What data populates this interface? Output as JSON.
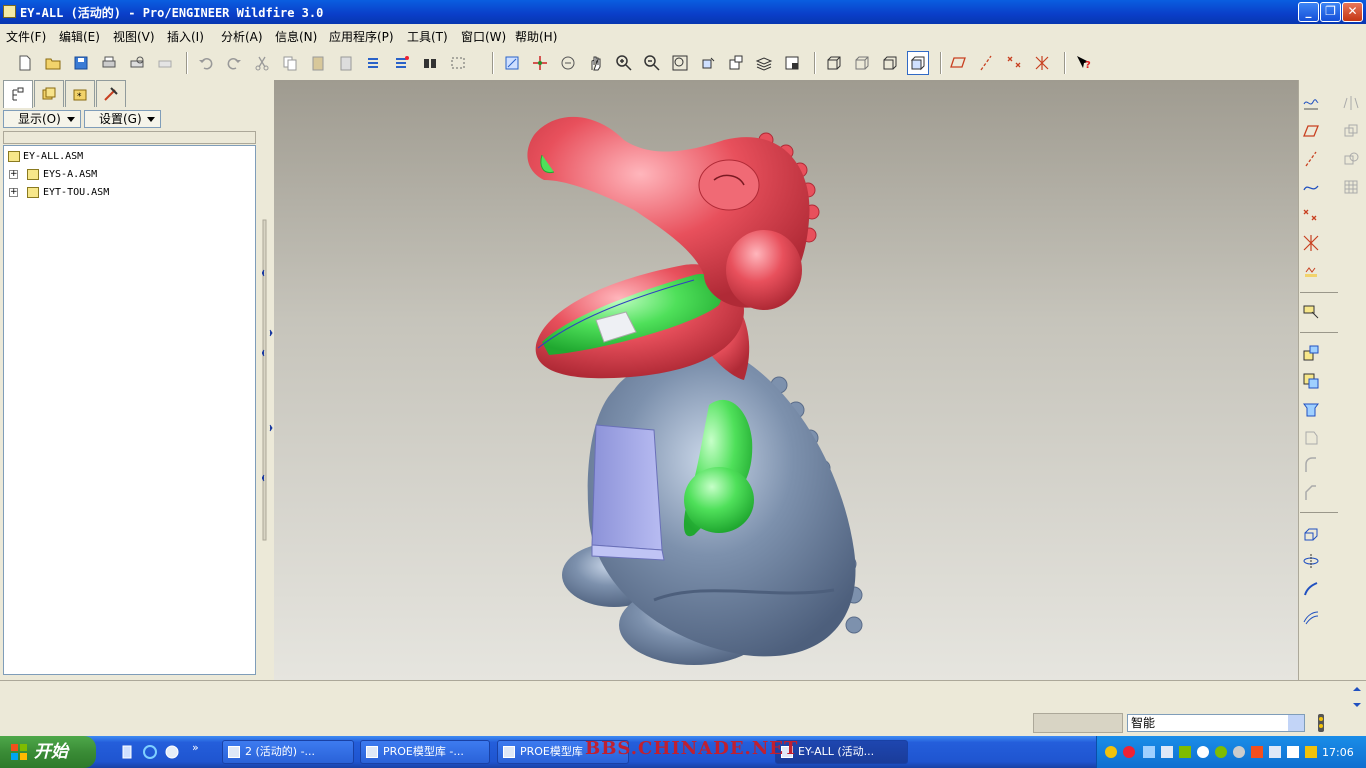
{
  "window": {
    "title": "EY-ALL (活动的) - Pro/ENGINEER Wildfire 3.0",
    "minimize_label": "_",
    "maximize_label": "❐",
    "close_label": "✕"
  },
  "menubar": {
    "items": [
      {
        "label": "文件(F)"
      },
      {
        "label": "编辑(E)"
      },
      {
        "label": "视图(V)"
      },
      {
        "label": "插入(I)"
      },
      {
        "label": "分析(A)"
      },
      {
        "label": "信息(N)"
      },
      {
        "label": "应用程序(P)"
      },
      {
        "label": "工具(T)"
      },
      {
        "label": "窗口(W)"
      },
      {
        "label": "帮助(H)"
      }
    ]
  },
  "model_tree": {
    "show_label": "显示(O)",
    "settings_label": "设置(G)",
    "nodes": [
      {
        "label": "EY-ALL.ASM"
      },
      {
        "label": "EYS-A.ASM"
      },
      {
        "label": "EYT-TOU.ASM"
      }
    ]
  },
  "status": {
    "filter_value": "智能"
  },
  "taskbar": {
    "start_label": "开始",
    "tasks": [
      {
        "label": "2 (活动的) -..."
      },
      {
        "label": "PROE模型库 -..."
      },
      {
        "label": "PROE模型库"
      },
      {
        "label": "EY-ALL (活动..."
      }
    ],
    "clock": "17:06",
    "watermark": "BBS.CHINADE.NET"
  },
  "colors": {
    "title_blue": "#0a4fd8",
    "head_red": "#e8505c",
    "body_steel": "#7d91ad",
    "accent_green": "#4fe05a"
  }
}
